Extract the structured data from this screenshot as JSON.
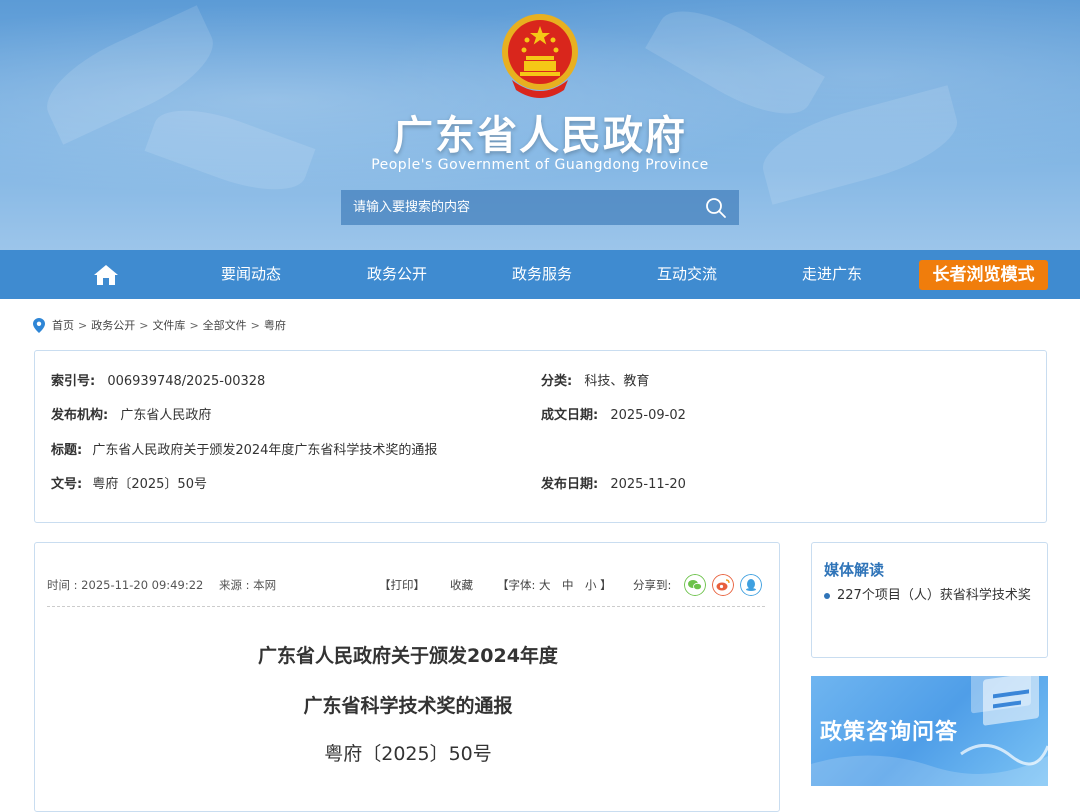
{
  "header": {
    "title": "广东省人民政府",
    "subtitle": "People's Government of Guangdong Province",
    "search_placeholder": "请输入要搜索的内容"
  },
  "nav": {
    "items": [
      "要闻动态",
      "政务公开",
      "政务服务",
      "互动交流",
      "走进广东"
    ],
    "elder_mode": "长者浏览模式"
  },
  "breadcrumb": [
    "首页",
    "政务公开",
    "文件库",
    "全部文件",
    "粤府"
  ],
  "info": {
    "index_label": "索引号:",
    "index_value": "006939748/2025-00328",
    "category_label": "分类:",
    "category_value": "科技、教育",
    "issuer_label": "发布机构:",
    "issuer_value": "广东省人民政府",
    "written_label": "成文日期:",
    "written_value": "2025-09-02",
    "title_label": "标题:",
    "title_value": "广东省人民政府关于颁发2024年度广东省科学技术奖的通报",
    "docno_label": "文号:",
    "docno_value": "粤府〔2025〕50号",
    "published_label": "发布日期:",
    "published_value": "2025-11-20"
  },
  "article": {
    "time": "时间 : 2025-11-20 09:49:22",
    "source": "来源 : 本网",
    "print": "【打印】",
    "favorite": "收藏",
    "font_size": "【字体: 大　中　小 】",
    "share": "分享到:",
    "title_line1": "广东省人民政府关于颁发2024年度",
    "title_line2": "广东省科学技术奖的通报",
    "doc_number": "粤府〔2025〕50号"
  },
  "sidebar": {
    "media_heading": "媒体解读",
    "media_link": "227个项目（人）获省科学技术奖",
    "banner_text": "政策咨询问答"
  },
  "colors": {
    "nav_bg": "#3f8bd0",
    "elder_button": "#f07d0c",
    "accent_blue": "#2f74b8"
  }
}
